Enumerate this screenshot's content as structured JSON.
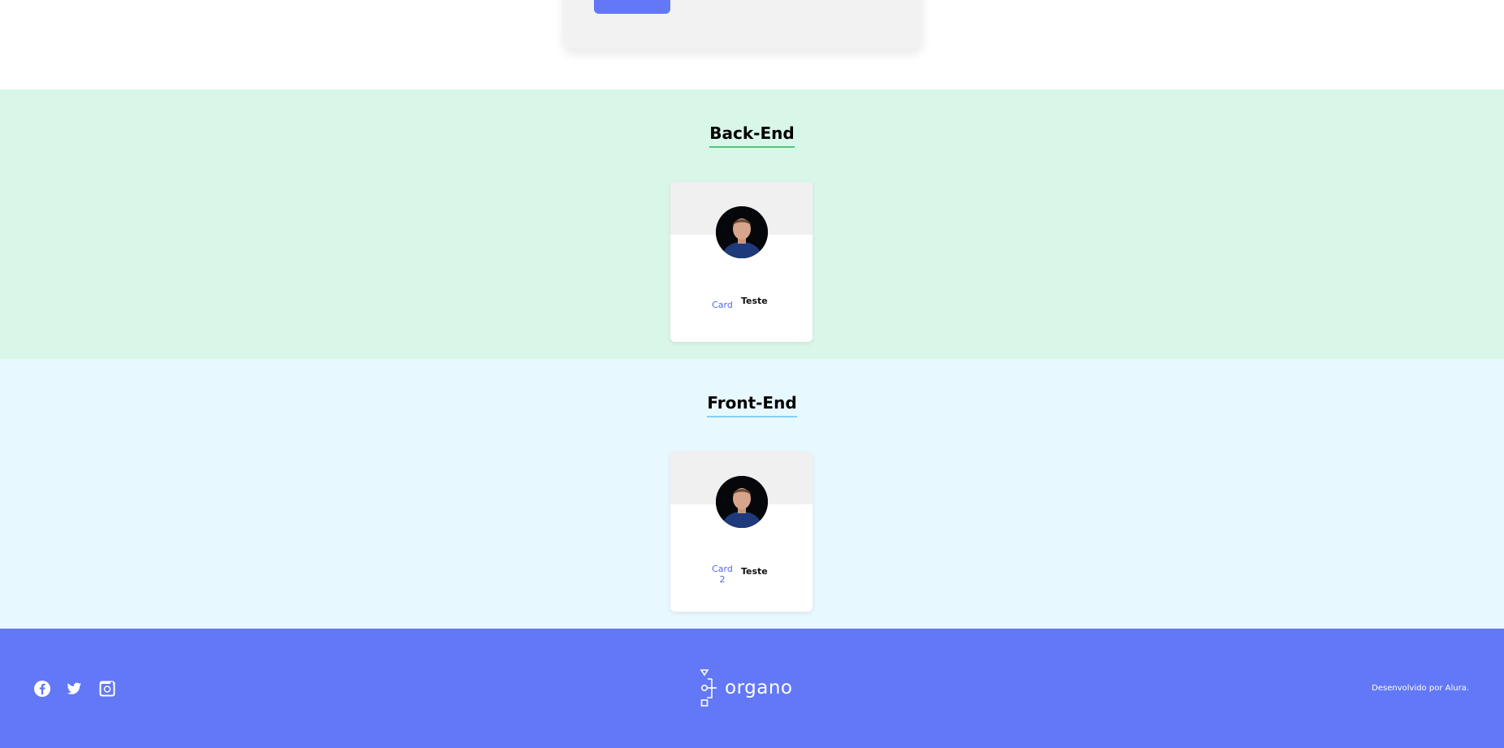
{
  "form": {
    "submit_button_label": ""
  },
  "teams": [
    {
      "title": "Back-End",
      "primary_color": "#57c278",
      "secondary_color": "#d9f7e9",
      "member": {
        "name": "Card",
        "role": "Teste",
        "photo": "person-photo"
      }
    },
    {
      "title": "Front-End",
      "primary_color": "#82cffa",
      "secondary_color": "#e8f8ff",
      "member": {
        "name": "Card 2",
        "role": "Teste",
        "photo": "person-photo"
      }
    }
  ],
  "footer": {
    "social": [
      "facebook-icon",
      "twitter-icon",
      "instagram-icon"
    ],
    "logo_text": "organo",
    "credit": "Desenvolvido por Alura.",
    "background_color": "#6278f7"
  }
}
